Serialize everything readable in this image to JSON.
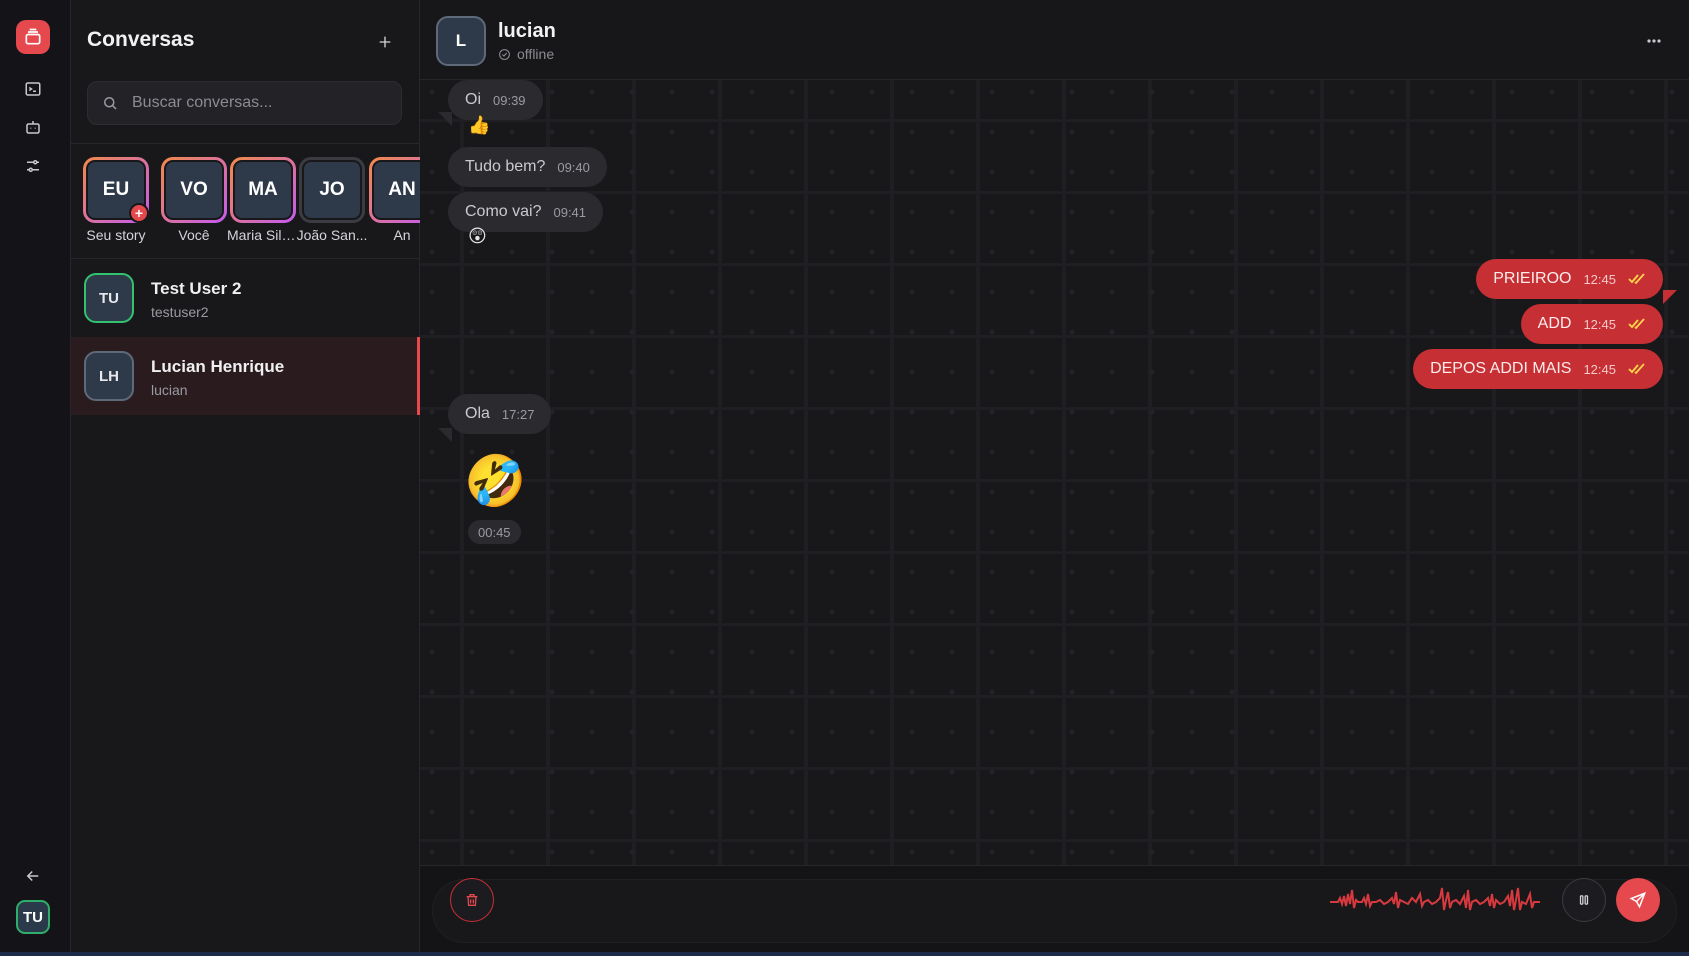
{
  "rail": {
    "logo_icon": "inbox-icon",
    "nav": [
      "terminal-icon",
      "bot-icon",
      "sliders-icon"
    ],
    "back_icon": "arrow-left-icon",
    "me_initials": "TU"
  },
  "sidebar": {
    "title": "Conversas",
    "new_icon": "plus-icon",
    "search_placeholder": "Buscar conversas...",
    "stories": [
      {
        "initials": "EU",
        "label": "Seu story",
        "ring": "gradient",
        "add": true
      },
      {
        "initials": "VO",
        "label": "Você",
        "ring": "gradient"
      },
      {
        "initials": "MA",
        "label": "Maria Silv...",
        "ring": "gradient"
      },
      {
        "initials": "JO",
        "label": "João San...",
        "ring": "plain"
      },
      {
        "initials": "AN",
        "label": "An",
        "ring": "gradient"
      }
    ],
    "conversations": [
      {
        "initials": "TU",
        "name": "Test User 2",
        "username": "testuser2",
        "active": false
      },
      {
        "initials": "LH",
        "name": "Lucian Henrique",
        "username": "lucian",
        "active": true
      }
    ]
  },
  "chat": {
    "contact_initial": "L",
    "contact_name": "lucian",
    "status": "offline",
    "messages": [
      {
        "dir": "in",
        "text": "Oi",
        "time": "09:39",
        "reaction": "👍"
      },
      {
        "dir": "in",
        "text": "Tudo bem?",
        "time": "09:40"
      },
      {
        "dir": "in",
        "text": "Como vai?",
        "time": "09:41",
        "reaction": "😲"
      },
      {
        "dir": "out",
        "text": "PRIEIROO",
        "time": "12:45",
        "read": true
      },
      {
        "dir": "out",
        "text": "ADD",
        "time": "12:45",
        "read": true
      },
      {
        "dir": "out",
        "text": "DEPOS ADDI MAIS",
        "time": "12:45",
        "read": true
      },
      {
        "dir": "in",
        "text": "Ola",
        "time": "17:27"
      }
    ],
    "sticker": "🤣",
    "sticker_duration": "00:45"
  },
  "composer": {
    "trash_icon": "trash-icon",
    "pause_icon": "pause-icon",
    "send_icon": "send-icon"
  },
  "colors": {
    "accent": "#e5484d",
    "out_bubble": "#c62f33",
    "in_bubble": "#2b2b2f"
  }
}
